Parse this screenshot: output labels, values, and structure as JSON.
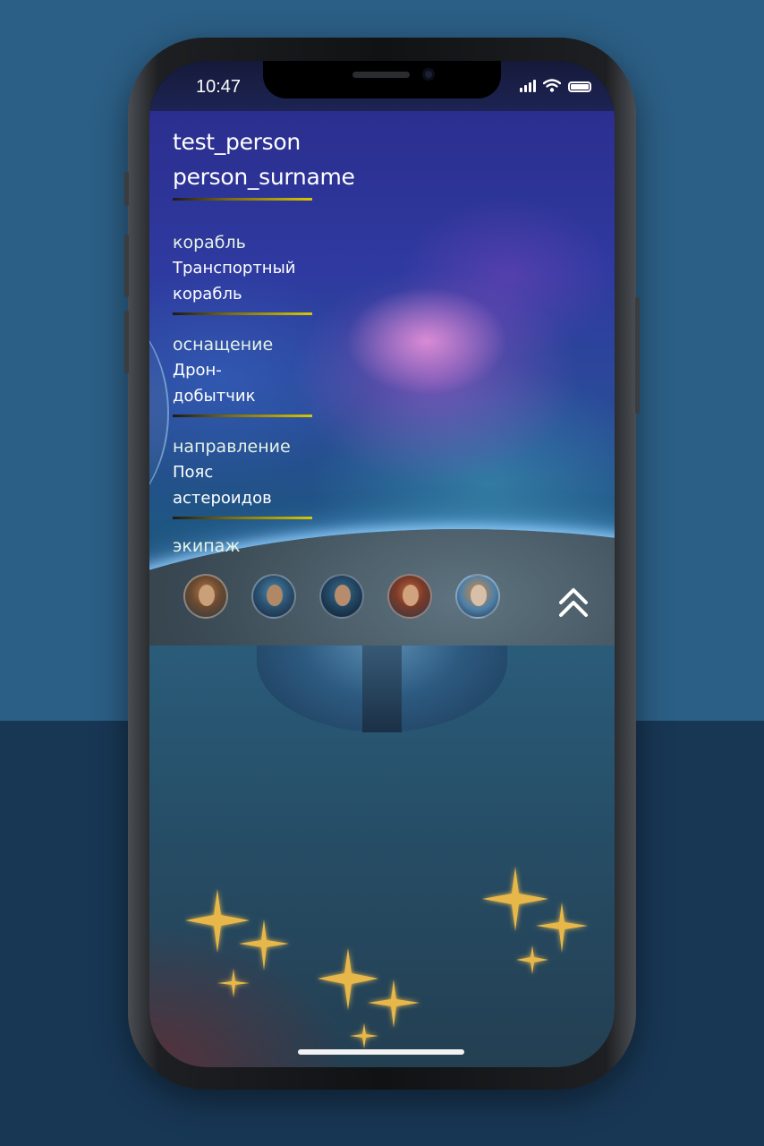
{
  "status_bar": {
    "time": "10:47"
  },
  "profile": {
    "first_name": "test_person",
    "last_name": "person_surname"
  },
  "details": [
    {
      "label": "корабль",
      "value_line1": "Транспортный",
      "value_line2": "корабль"
    },
    {
      "label": "оснащение",
      "value_line1": "Дрон-",
      "value_line2": "добытчик"
    },
    {
      "label": "направление",
      "value_line1": "Пояс",
      "value_line2": "астероидов"
    }
  ],
  "crew": {
    "label": "экипаж",
    "members": [
      {
        "icon": "avatar-crew-1"
      },
      {
        "icon": "avatar-crew-2"
      },
      {
        "icon": "avatar-crew-3"
      },
      {
        "icon": "avatar-crew-4"
      },
      {
        "icon": "avatar-crew-5"
      }
    ]
  },
  "collapse_button": {
    "icon": "double-chevron-up-icon"
  },
  "colors": {
    "divider_gold": "#d9c600",
    "sparkle_gold": "#e7b84a",
    "background_top": "#2c5f86",
    "background_bottom": "#183755"
  }
}
